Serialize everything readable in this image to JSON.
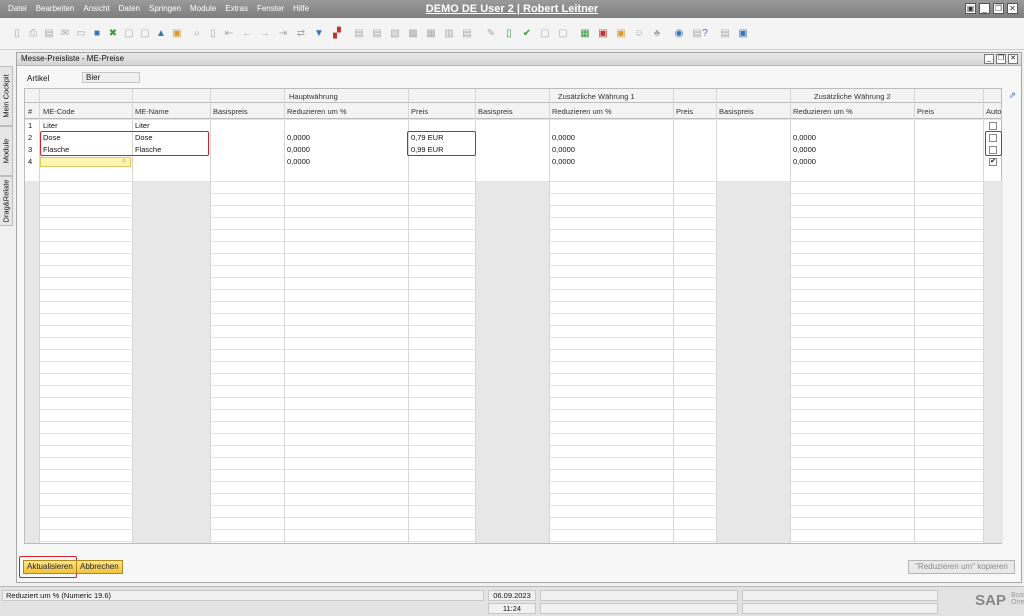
{
  "menu": [
    "Datei",
    "Bearbeiten",
    "Ansicht",
    "Daten",
    "Springen",
    "Module",
    "Extras",
    "Fenster",
    "Hilfe"
  ],
  "app_title": "DEMO DE User 2 | Robert Leitner",
  "side_tabs": [
    "Mein Cockpit",
    "Module",
    "Drag&Relate"
  ],
  "form": {
    "title": "Messe-Preisliste - ME-Preise",
    "artikel_label": "Artikel",
    "artikel_value": "Bier"
  },
  "grid": {
    "group_headers": [
      "Hauptwährung",
      "Zusätzliche Währung 1",
      "Zusätzliche Währung 2"
    ],
    "columns": [
      "#",
      "ME-Code",
      "ME-Name",
      "Basispreis",
      "Reduzieren um %",
      "Preis",
      "Basispreis",
      "Reduzieren um %",
      "Preis",
      "Basispreis",
      "Reduzieren um %",
      "Preis",
      "Auto"
    ],
    "rows": [
      {
        "num": "1",
        "code": "Liter",
        "name": "Liter",
        "red1": "",
        "preis": "",
        "red2": "",
        "red3": "",
        "auto": false
      },
      {
        "num": "2",
        "code": "Dose",
        "name": "Dose",
        "red1": "0,0000",
        "preis": "0,79 EUR",
        "red2": "0,0000",
        "red3": "0,0000",
        "auto": false
      },
      {
        "num": "3",
        "code": "Flasche",
        "name": "Flasche",
        "red1": "0,0000",
        "preis": "0,99 EUR",
        "red2": "0,0000",
        "red3": "0,0000",
        "auto": false
      },
      {
        "num": "4",
        "code": "",
        "name": "",
        "red1": "0,0000",
        "preis": "",
        "red2": "0,0000",
        "red3": "0,0000",
        "auto": true
      }
    ]
  },
  "buttons": {
    "update": "Aktualisieren",
    "cancel": "Abbrechen",
    "copy": "\"Reduzieren um\" kopieren"
  },
  "status": {
    "message": "Reduziert um % (Numeric 19.6)",
    "date": "06.09.2023",
    "time": "11:24",
    "logo": "SAP",
    "logo_sub": "Business One"
  },
  "colors": {
    "highlight": "#d0202a",
    "button": "#f2c23a"
  }
}
